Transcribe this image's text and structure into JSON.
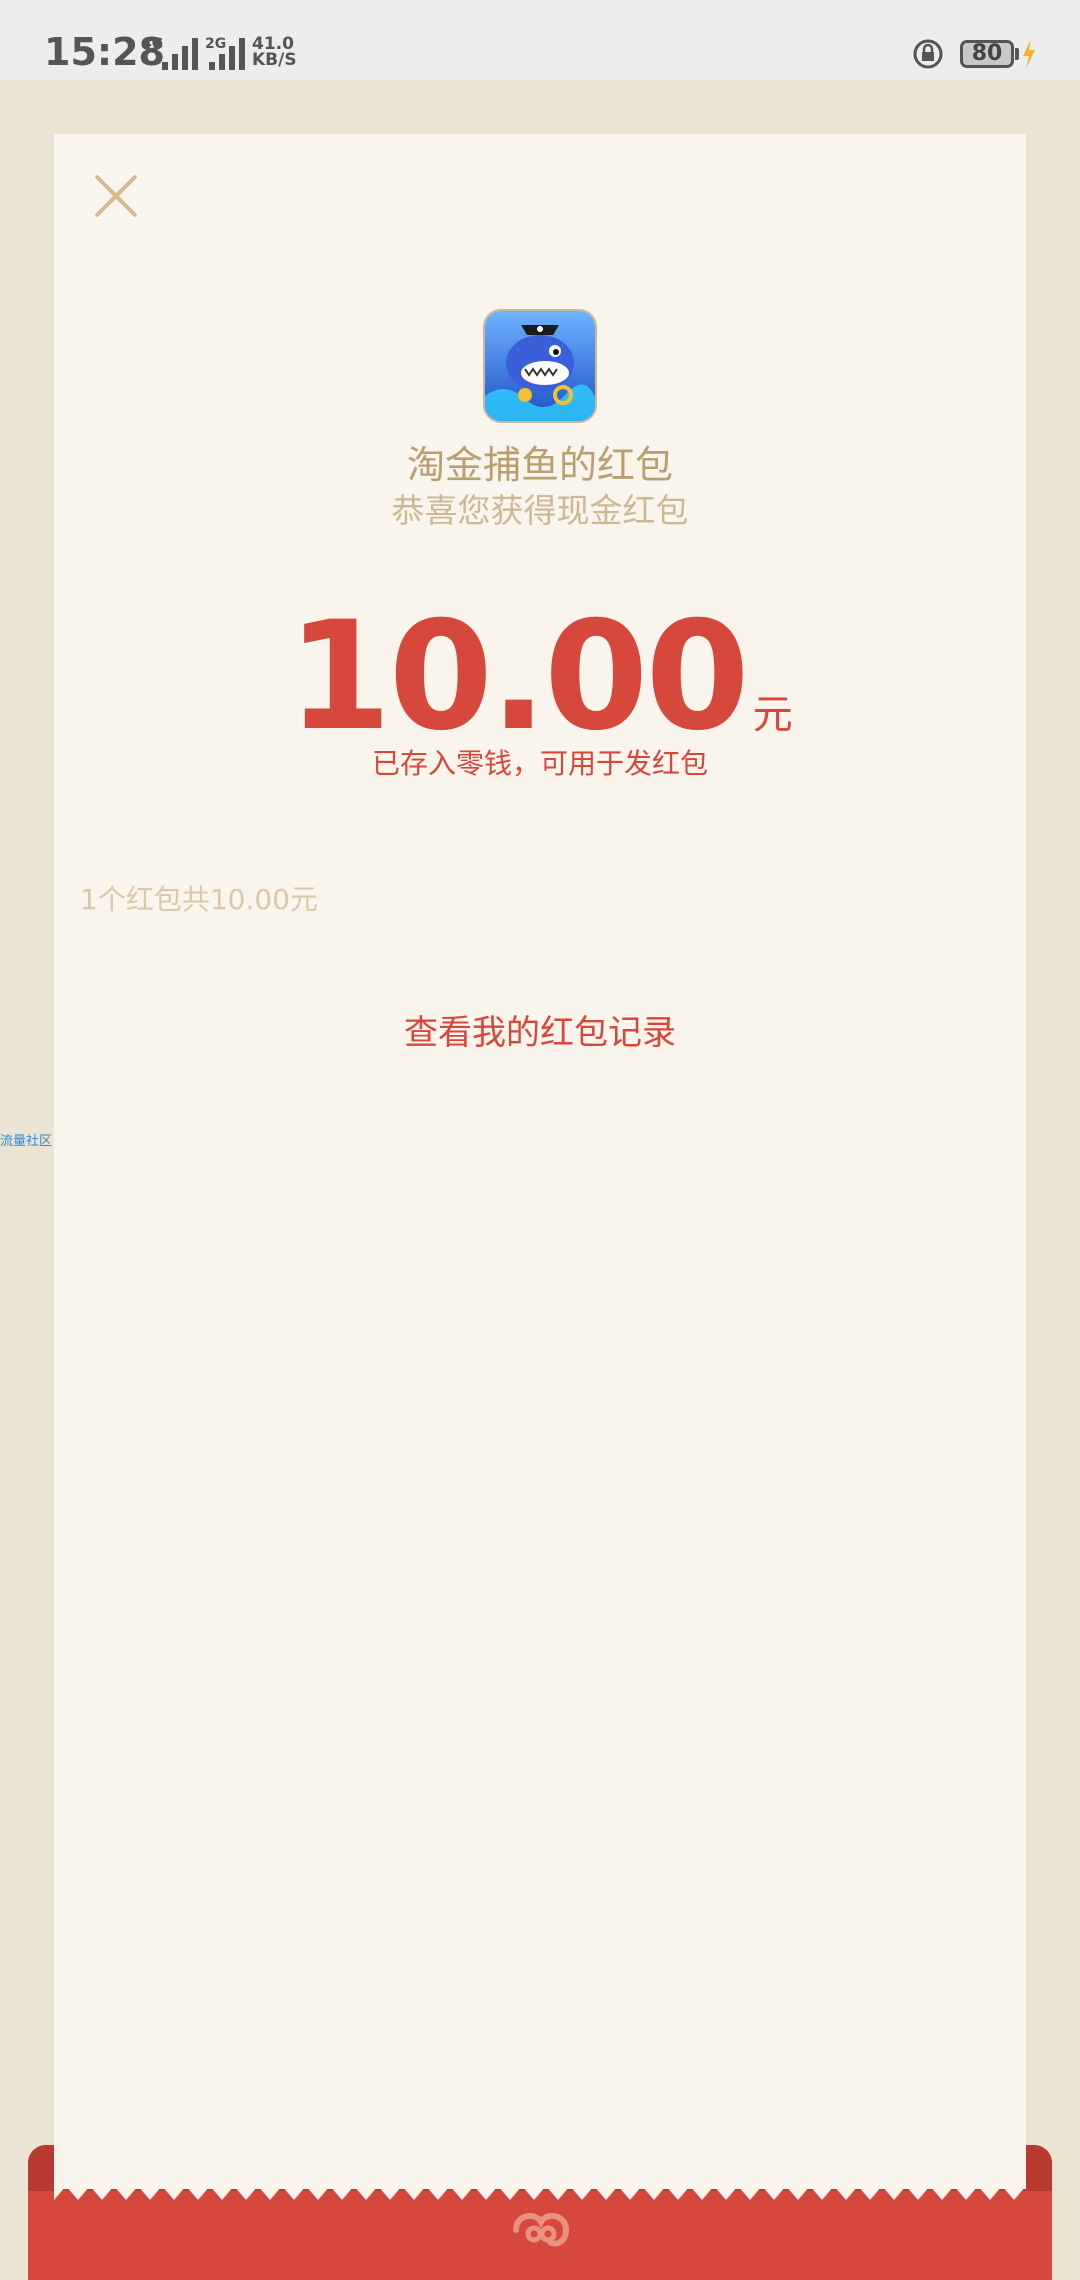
{
  "status_bar": {
    "time": "15:28",
    "network1": "4G",
    "network2": "2G",
    "speed_value": "41.0",
    "speed_unit": "KB/S",
    "battery": "80"
  },
  "redpacket": {
    "title": "淘金捕鱼的红包",
    "subtitle": "恭喜您获得现金红包",
    "amount": "10.00",
    "unit": "元",
    "note": "已存入零钱，可用于发红包",
    "count_text": "1个红包共10.00元",
    "record_link": "查看我的红包记录"
  },
  "side_link": "流量社区",
  "colors": {
    "accent_red": "#d6473c",
    "gold_text": "#b99e6e",
    "paper": "#f9f5ec",
    "background": "#ece4d2"
  },
  "icons": [
    "close-icon",
    "app-icon-shark",
    "lock-rotation-icon",
    "battery-icon",
    "charging-bolt-icon",
    "red-packet-logo-icon"
  ]
}
